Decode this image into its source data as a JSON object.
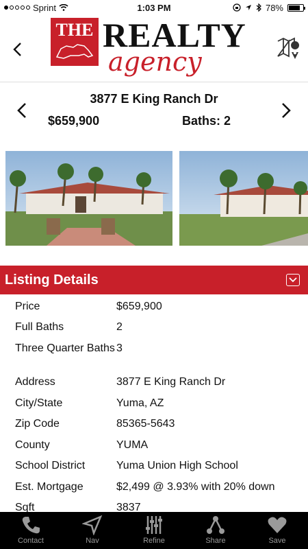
{
  "status_bar": {
    "carrier": "Sprint",
    "time": "1:03 PM",
    "battery": "78%",
    "battery_level": 0.78
  },
  "header": {
    "logo_the": "THE",
    "logo_realty": "REALTY",
    "logo_agency": "agency",
    "back_icon": "chevron-left-icon",
    "map_icon": "map-pin-icon"
  },
  "property": {
    "address": "3877 E King Ranch Dr",
    "price": "$659,900",
    "baths": "Baths: 2"
  },
  "listing": {
    "title": "Listing Details",
    "rows": [
      {
        "label": "Price",
        "value": "$659,900"
      },
      {
        "label": "Full Baths",
        "value": "2"
      },
      {
        "label": "Three Quarter Baths",
        "value": "3"
      },
      {
        "label": "Address",
        "value": "3877 E King Ranch Dr"
      },
      {
        "label": "City/State",
        "value": "Yuma, AZ"
      },
      {
        "label": "Zip Code",
        "value": "85365-5643"
      },
      {
        "label": "County",
        "value": "YUMA"
      },
      {
        "label": "School District",
        "value": "Yuma Union High School"
      },
      {
        "label": "Est. Mortgage",
        "value": "$2,499 @ 3.93% with 20% down"
      },
      {
        "label": "Sqft",
        "value": "3837"
      }
    ]
  },
  "nav": {
    "items": [
      {
        "label": "Contact",
        "icon": "phone-icon"
      },
      {
        "label": "Nav",
        "icon": "navigation-arrow-icon"
      },
      {
        "label": "Refine",
        "icon": "sliders-icon"
      },
      {
        "label": "Share",
        "icon": "share-icon"
      },
      {
        "label": "Save",
        "icon": "heart-icon"
      }
    ]
  },
  "colors": {
    "brand_red": "#c8202a",
    "nav_bg": "#000000",
    "nav_text": "#9a9a9a"
  }
}
